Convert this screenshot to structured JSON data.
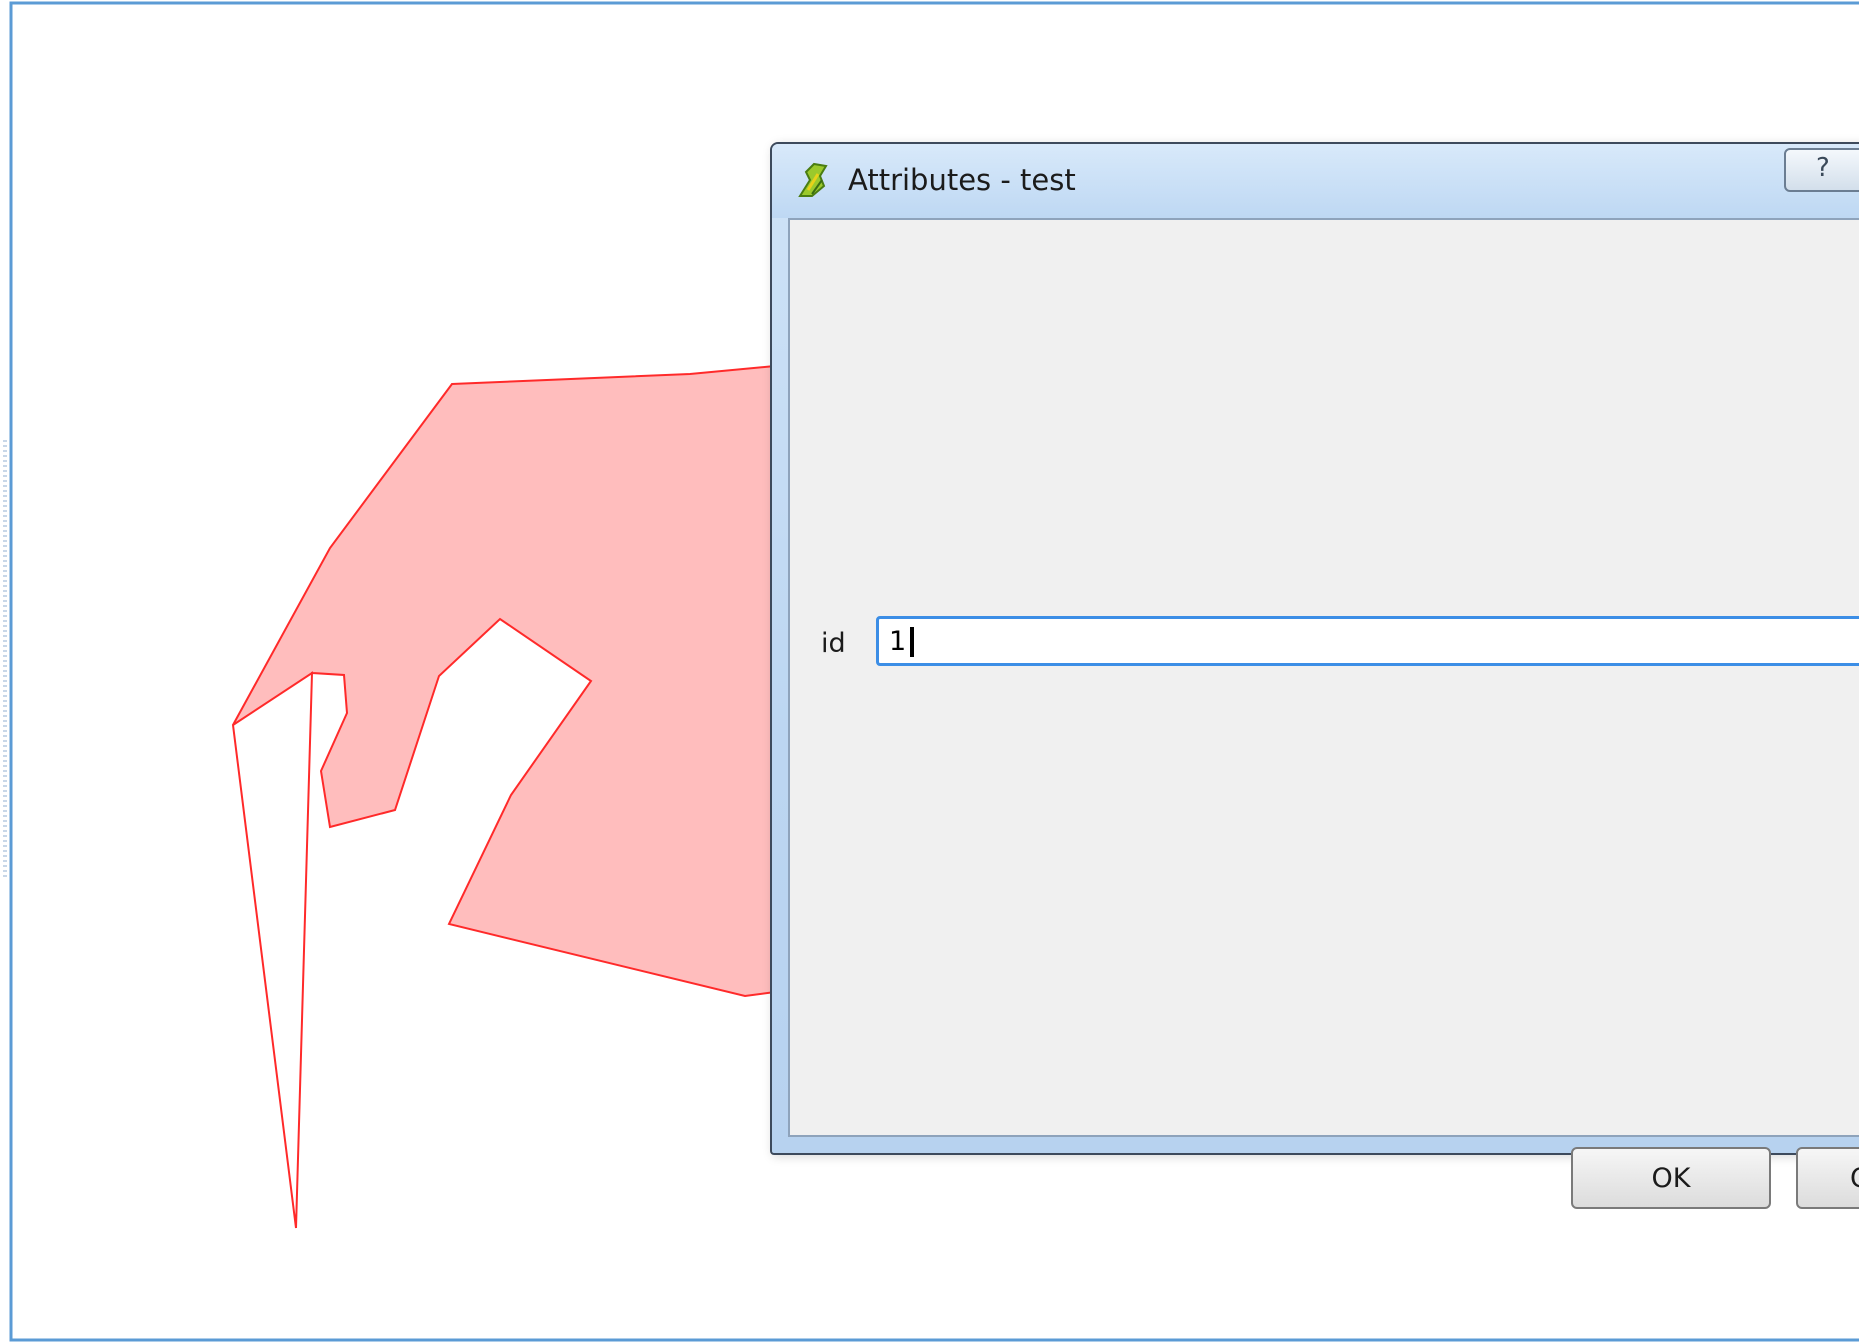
{
  "dialog": {
    "title": "Attributes - test",
    "help_label": "?",
    "ok_label": "OK",
    "cancel_label": "Ca"
  },
  "form": {
    "fields": [
      {
        "label": "id",
        "value": "1"
      }
    ]
  },
  "colors": {
    "polygon_fill": "#ffbdbd",
    "polygon_stroke": "#ff2a2a",
    "canvas_frame": "#5b9bd5",
    "focus_border": "#3c8ee6"
  },
  "icons": {
    "app": "qgis-icon"
  }
}
